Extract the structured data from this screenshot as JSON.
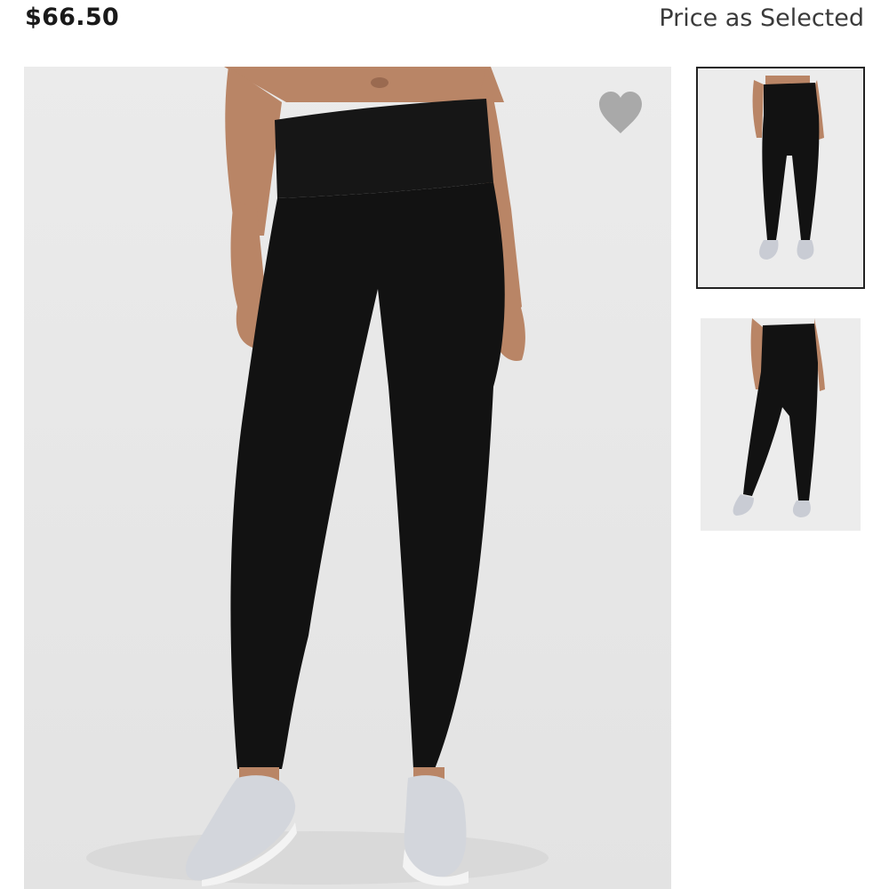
{
  "product": {
    "price": "$66.50",
    "price_note": "Price as Selected"
  },
  "icons": {
    "favorite": "heart-icon"
  },
  "colors": {
    "text": "#1a1a1a",
    "image_background": "#e8e8e8",
    "heart": "#a9a9a9",
    "selected_border": "#222222"
  },
  "gallery": {
    "thumbnails": [
      {
        "name": "front-view",
        "selected": true
      },
      {
        "name": "back-view",
        "selected": false
      }
    ]
  }
}
